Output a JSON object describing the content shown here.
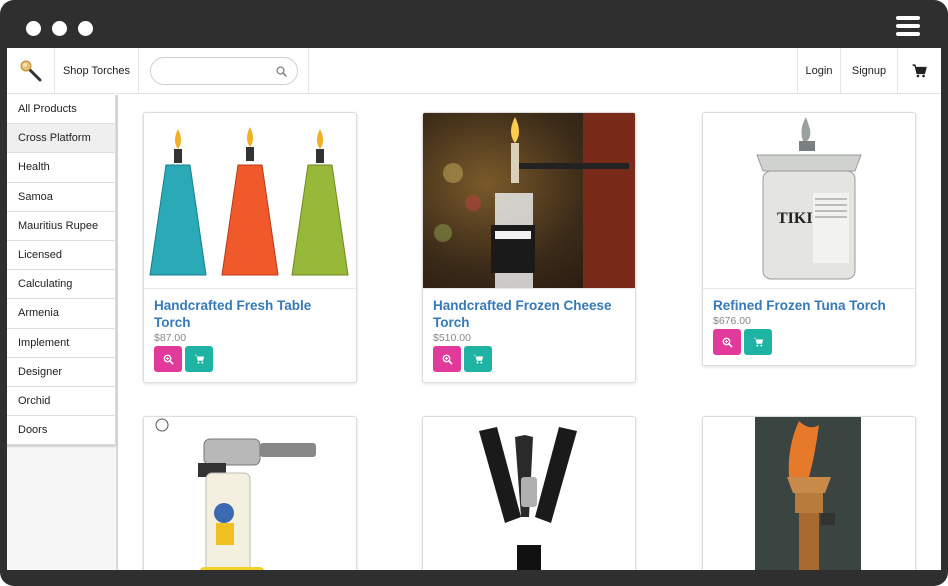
{
  "window": {
    "controls": [
      "dot",
      "dot",
      "dot"
    ],
    "menu_icon": "hamburger-icon"
  },
  "navbar": {
    "brand_icon": "torch-logo-icon",
    "shop_label": "Shop Torches",
    "search": {
      "placeholder": "",
      "value": "",
      "icon": "search-icon"
    },
    "login_label": "Login",
    "signup_label": "Signup",
    "cart_icon": "shopping-cart-icon"
  },
  "sidebar": {
    "items": [
      {
        "label": "All Products"
      },
      {
        "label": "Cross Platform",
        "active": true
      },
      {
        "label": "Health"
      },
      {
        "label": "Samoa"
      },
      {
        "label": "Mauritius Rupee"
      },
      {
        "label": "Licensed"
      },
      {
        "label": "Calculating"
      },
      {
        "label": "Armenia"
      },
      {
        "label": "Implement"
      },
      {
        "label": "Designer"
      },
      {
        "label": "Orchid"
      },
      {
        "label": "Doors"
      }
    ]
  },
  "products": [
    {
      "title": "Handcrafted Fresh Table Torch",
      "price": "$87.00",
      "image": "colorful-glass-table-torches"
    },
    {
      "title": "Handcrafted Frozen Cheese Torch",
      "price": "$510.00",
      "image": "whiskey-bottle-torch"
    },
    {
      "title": "Refined Frozen Tuna Torch",
      "price": "$676.00",
      "image": "tiki-fuel-canister"
    },
    {
      "title": "",
      "price": "",
      "image": "butane-kitchen-torch"
    },
    {
      "title": "",
      "price": "",
      "image": "black-metal-garden-torch"
    },
    {
      "title": "",
      "price": "",
      "image": "copper-wall-torch"
    }
  ],
  "colors": {
    "title_blue": "#3579b8",
    "zoom_pink": "#e23a9a",
    "cart_teal": "#1fb3a3",
    "frame": "#2f2f2f"
  }
}
